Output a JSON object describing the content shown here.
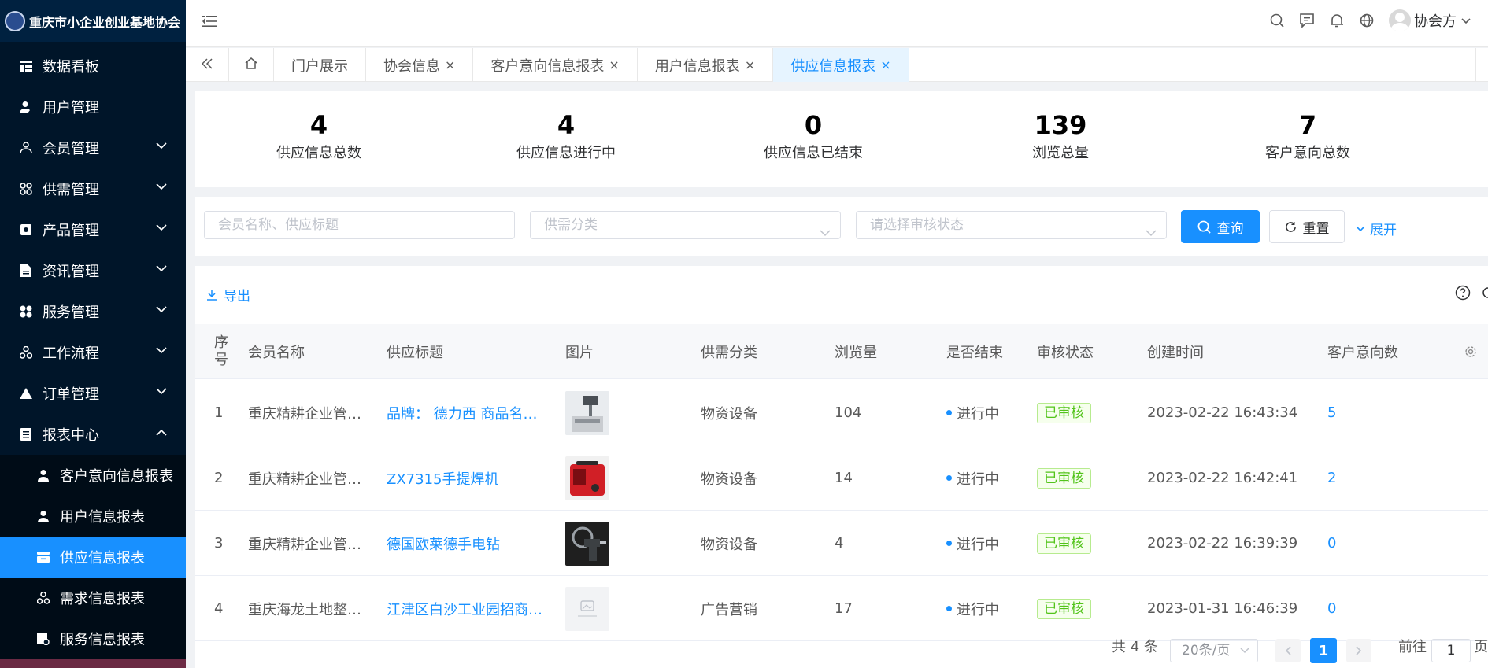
{
  "app": {
    "title": "重庆市小企业创业基地协会"
  },
  "sidebar": {
    "items": [
      {
        "label": "数据看板",
        "icon": "dashboard-icon"
      },
      {
        "label": "用户管理",
        "icon": "user-icon"
      },
      {
        "label": "会员管理",
        "icon": "members-icon"
      },
      {
        "label": "供需管理",
        "icon": "grid-icon"
      },
      {
        "label": "产品管理",
        "icon": "product-icon"
      },
      {
        "label": "资讯管理",
        "icon": "document-icon"
      },
      {
        "label": "服务管理",
        "icon": "service-icon"
      },
      {
        "label": "工作流程",
        "icon": "workflow-icon"
      },
      {
        "label": "订单管理",
        "icon": "order-icon"
      },
      {
        "label": "报表中心",
        "icon": "report-icon"
      }
    ],
    "subitems": [
      {
        "label": "客户意向信息报表"
      },
      {
        "label": "用户信息报表"
      },
      {
        "label": "供应信息报表"
      },
      {
        "label": "需求信息报表"
      },
      {
        "label": "服务信息报表"
      }
    ]
  },
  "header": {
    "user_name": "协会方"
  },
  "tabs": [
    {
      "label": "门户展示"
    },
    {
      "label": "协会信息"
    },
    {
      "label": "客户意向信息报表"
    },
    {
      "label": "用户信息报表"
    },
    {
      "label": "供应信息报表"
    }
  ],
  "stats": [
    {
      "value": "4",
      "label": "供应信息总数"
    },
    {
      "value": "4",
      "label": "供应信息进行中"
    },
    {
      "value": "0",
      "label": "供应信息已结束"
    },
    {
      "value": "139",
      "label": "浏览总量"
    },
    {
      "value": "7",
      "label": "客户意向总数"
    }
  ],
  "search": {
    "keyword_placeholder": "会员名称、供应标题",
    "category_placeholder": "供需分类",
    "status_placeholder": "请选择审核状态",
    "query_label": "查询",
    "reset_label": "重置",
    "expand_label": "展开"
  },
  "table": {
    "export_label": "导出",
    "columns": [
      "序号",
      "会员名称",
      "供应标题",
      "图片",
      "供需分类",
      "浏览量",
      "是否结束",
      "审核状态",
      "创建时间",
      "客户意向数"
    ],
    "rows": [
      {
        "index": "1",
        "member": "重庆精耕企业管…",
        "title": "品牌： 德力西 商品名…",
        "category": "物资设备",
        "views": "104",
        "ended": "进行中",
        "status": "已审核",
        "created": "2023-02-22 16:43:34",
        "intents": "5"
      },
      {
        "index": "2",
        "member": "重庆精耕企业管…",
        "title": "ZX7315手提焊机",
        "category": "物资设备",
        "views": "14",
        "ended": "进行中",
        "status": "已审核",
        "created": "2023-02-22 16:42:41",
        "intents": "2"
      },
      {
        "index": "3",
        "member": "重庆精耕企业管…",
        "title": "德国欧莱德手电钻",
        "category": "物资设备",
        "views": "4",
        "ended": "进行中",
        "status": "已审核",
        "created": "2023-02-22 16:39:39",
        "intents": "0"
      },
      {
        "index": "4",
        "member": "重庆海龙土地整…",
        "title": "江津区白沙工业园招商…",
        "category": "广告营销",
        "views": "17",
        "ended": "进行中",
        "status": "已审核",
        "created": "2023-01-31 16:46:39",
        "intents": "0"
      }
    ]
  },
  "pagination": {
    "total": "共 4 条",
    "page_size": "20条/页",
    "current": "1",
    "goto_label": "前往",
    "goto_value": "1",
    "page_suffix": "页"
  },
  "colors": {
    "accent": "#1890ff",
    "sidebar_bg": "#001529",
    "success": "#52c41a"
  }
}
